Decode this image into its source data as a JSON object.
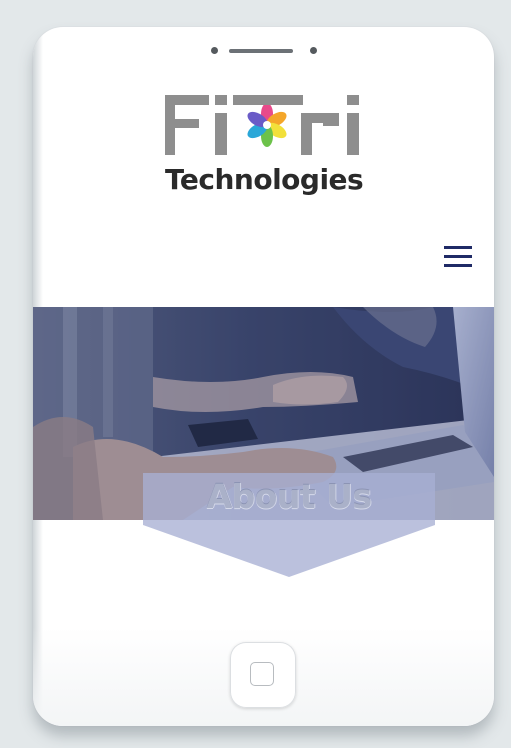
{
  "logo": {
    "wordmark": "FITRI",
    "subtitle": "Technologies",
    "flower_colors": [
      "#e84a8a",
      "#f4a62a",
      "#f2e03a",
      "#6cc24a",
      "#2aa7d8",
      "#6a5bc7"
    ]
  },
  "header": {
    "menu_icon": "hamburger-menu-icon"
  },
  "hero": {
    "image_description_icon": "laptop-photo",
    "overlay_color": "#2d3a78"
  },
  "about": {
    "title": "About Us"
  },
  "device": {
    "home_button_icon": "home-square-icon"
  },
  "colors": {
    "brand_navy": "#1f2a66",
    "logo_gray": "#8a8a8a",
    "banner_tint": "#a8b0d4"
  }
}
